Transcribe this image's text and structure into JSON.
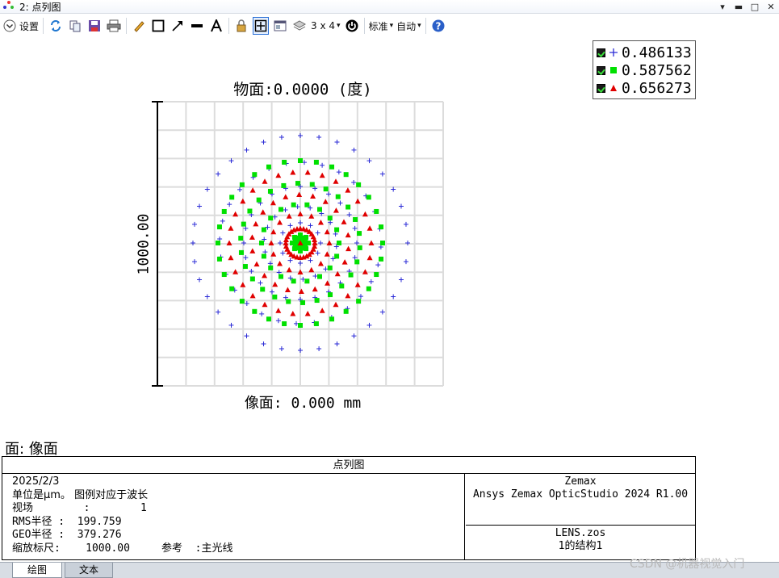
{
  "window": {
    "title": "2: 点列图"
  },
  "toolbar": {
    "settings_label": "设置",
    "grid_label": "3 x 4",
    "standard_label": "标准",
    "auto_label": "自动"
  },
  "legend": {
    "entries": [
      {
        "value": "0.486133",
        "marker": "plus",
        "color": "#2a2ad6"
      },
      {
        "value": "0.587562",
        "marker": "square",
        "color": "#00e000"
      },
      {
        "value": "0.656273",
        "marker": "triangle",
        "color": "#e00000"
      }
    ]
  },
  "plot": {
    "object_label": "物面:0.0000 (度)",
    "image_label": "像面: 0.000 mm",
    "scale_label": "1000.00",
    "surface_label": "面: 像面"
  },
  "info": {
    "header": "点列图",
    "date": "2025/2/3",
    "units_line": "单位是μm。 图例对应于波长",
    "field_line": "视场        :        1",
    "rms_line": "RMS半径 :  199.759",
    "geo_line": "GEO半径 :  379.276",
    "scale_line": "缩放标尺:    1000.00",
    "reference_line": "参考  :主光线",
    "company": "Zemax",
    "product": "Ansys Zemax OpticStudio 2024 R1.00",
    "file": "LENS.zos",
    "config": "1的结构1"
  },
  "tabs": {
    "plot": "绘图",
    "text": "文本"
  },
  "watermark": "CSDN @机器视觉入门"
}
